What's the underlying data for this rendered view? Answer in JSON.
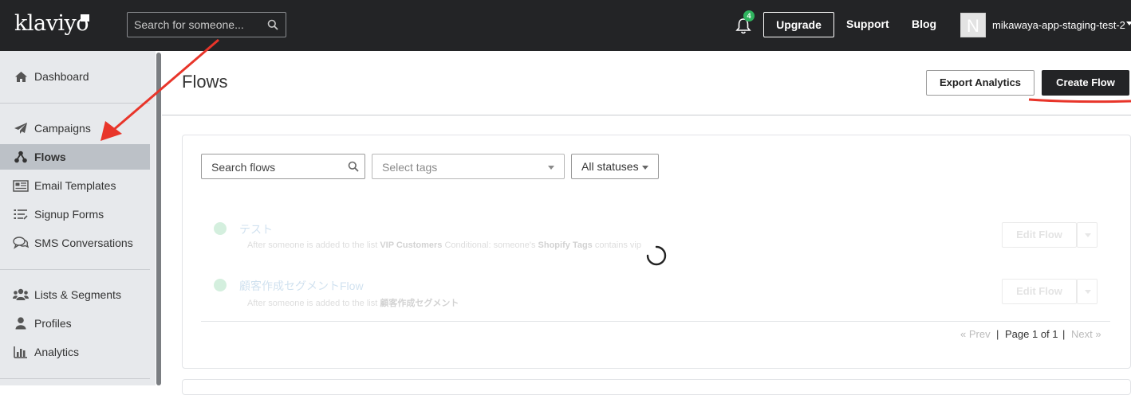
{
  "topbar": {
    "logo": "klaviyo",
    "search_placeholder": "Search for someone...",
    "notification_count": "4",
    "upgrade_label": "Upgrade",
    "support_label": "Support",
    "blog_label": "Blog",
    "avatar_letter": "N",
    "account_name": "mikawaya-app-staging-test-2"
  },
  "sidebar": {
    "items": [
      {
        "label": "Dashboard",
        "icon": "home-icon"
      },
      {
        "label": "Campaigns",
        "icon": "paper-plane-icon"
      },
      {
        "label": "Flows",
        "icon": "flows-icon",
        "active": true
      },
      {
        "label": "Email Templates",
        "icon": "newspaper-icon"
      },
      {
        "label": "Signup Forms",
        "icon": "list-form-icon"
      },
      {
        "label": "SMS Conversations",
        "icon": "chat-icon"
      },
      {
        "label": "Lists & Segments",
        "icon": "users-icon"
      },
      {
        "label": "Profiles",
        "icon": "user-icon"
      },
      {
        "label": "Analytics",
        "icon": "bar-chart-icon"
      }
    ]
  },
  "page": {
    "title": "Flows",
    "export_label": "Export Analytics",
    "create_label": "Create Flow"
  },
  "filters": {
    "search_placeholder": "Search flows",
    "tags_placeholder": "Select tags",
    "status_value": "All statuses"
  },
  "flows": [
    {
      "name": "テスト",
      "desc_prefix": "After someone is added to the list",
      "desc_list": "VIP Customers",
      "desc_mid": "Conditional: someone's",
      "desc_prop": "Shopify Tags",
      "desc_suffix": "contains vip",
      "edit_label": "Edit Flow"
    },
    {
      "name": "顧客作成セグメントFlow",
      "desc_prefix": "After someone is added to the list",
      "desc_list": "顧客作成セグメント",
      "edit_label": "Edit Flow"
    }
  ],
  "pagination": {
    "prev": "« Prev",
    "sep": "|",
    "page": "Page 1 of 1",
    "next": "Next »"
  },
  "colors": {
    "topbar": "#232426",
    "sidebar": "#e7e9ec",
    "active_item": "#bcc1c7",
    "annotation": "#e8352a",
    "status_green": "#2fb35e"
  }
}
